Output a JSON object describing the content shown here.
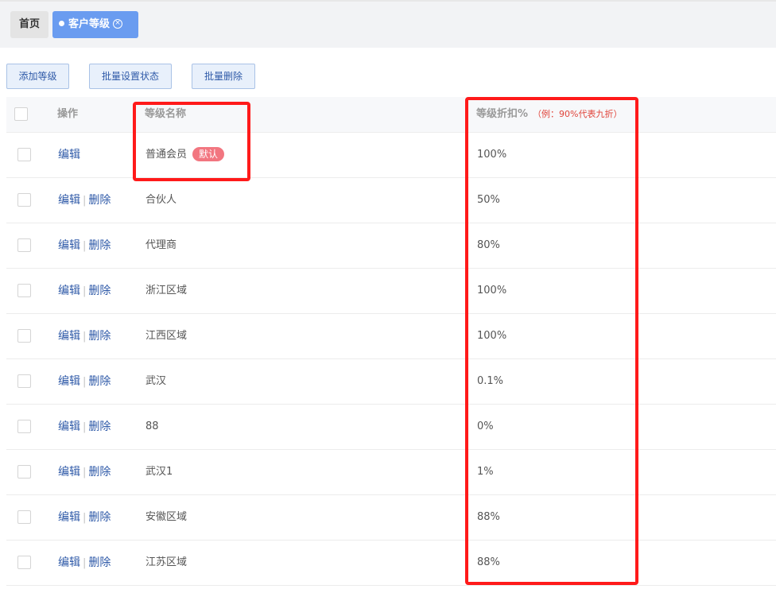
{
  "tabs": {
    "home_label": "首页",
    "active_label": "客户等级"
  },
  "toolbar": {
    "add_label": "添加等级",
    "batch_status_label": "批量设置状态",
    "batch_delete_label": "批量删除"
  },
  "table": {
    "headers": {
      "operation": "操作",
      "name": "等级名称",
      "discount": "等级折扣%",
      "discount_hint": "（例：90%代表九折）"
    },
    "edit_label": "编辑",
    "delete_label": "删除",
    "default_badge": "默认",
    "rows": [
      {
        "name": "普通会员",
        "discount": "100%"
      },
      {
        "name": "合伙人",
        "discount": "50%"
      },
      {
        "name": "代理商",
        "discount": "80%"
      },
      {
        "name": "浙江区域",
        "discount": "100%"
      },
      {
        "name": "江西区域",
        "discount": "100%"
      },
      {
        "name": "武汉",
        "discount": "0.1%"
      },
      {
        "name": "88",
        "discount": "0%"
      },
      {
        "name": "武汉1",
        "discount": "1%"
      },
      {
        "name": "安徽区域",
        "discount": "88%"
      },
      {
        "name": "江苏区域",
        "discount": "88%"
      }
    ]
  },
  "colors": {
    "accent": "#6a9cf0",
    "link": "#2f5aa8",
    "badge": "#f27680",
    "highlight": "#ff1a1a"
  }
}
